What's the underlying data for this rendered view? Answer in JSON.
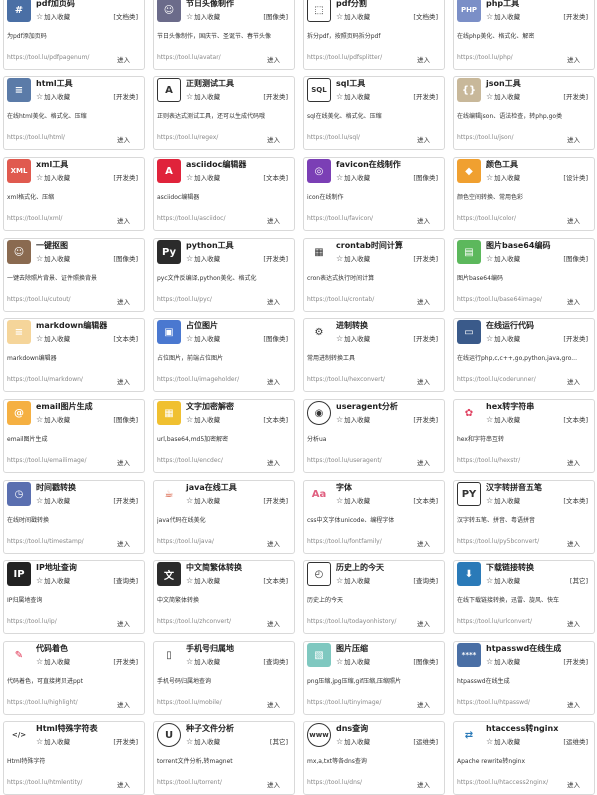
{
  "fav_label": "加入收藏",
  "enter_label": "进入",
  "tools": [
    {
      "title": "pdf加页码",
      "tag": "[文档类]",
      "desc": "为pdf添加页码",
      "link": "https://tool.lu/pdfpagenum/",
      "icon": "pdf-page-icon",
      "icon_text": "#",
      "color": "#4a6fa5"
    },
    {
      "title": "节日头像制作",
      "tag": "[图像类]",
      "desc": "节日头像制作，国庆节、圣诞节、春节头像",
      "link": "https://tool.lu/avatar/",
      "icon": "avatar-icon",
      "icon_text": "☺",
      "color": "#6b6b8a"
    },
    {
      "title": "pdf分割",
      "tag": "[文档类]",
      "desc": "拆分pdf，按照页码拆分pdf",
      "link": "https://tool.lu/pdfsplitter/",
      "icon": "pdf-split-icon",
      "icon_text": "⬚",
      "color": "#ffffff"
    },
    {
      "title": "php工具",
      "tag": "[开发类]",
      "desc": "在线php美化、格式化、解密",
      "link": "https://tool.lu/php/",
      "icon": "php-icon",
      "icon_text": "PHP",
      "color": "#7b8fc7"
    },
    {
      "title": "html工具",
      "tag": "[开发类]",
      "desc": "在线html美化、格式化、压缩",
      "link": "https://tool.lu/html/",
      "icon": "html-icon",
      "icon_text": "≡",
      "color": "#5b7ba8"
    },
    {
      "title": "正则测试工具",
      "tag": "[开发类]",
      "desc": "正则表达式测试工具，还可以生成代码哦",
      "link": "https://tool.lu/regex/",
      "icon": "regex-icon",
      "icon_text": "A",
      "color": "#ffffff"
    },
    {
      "title": "sql工具",
      "tag": "[开发类]",
      "desc": "sql在线美化、格式化、压缩",
      "link": "https://tool.lu/sql/",
      "icon": "sql-icon",
      "icon_text": "SQL",
      "color": "#ffffff"
    },
    {
      "title": "json工具",
      "tag": "[开发类]",
      "desc": "在线编辑json、语法检查，转php,go类",
      "link": "https://tool.lu/json/",
      "icon": "json-icon",
      "icon_text": "{}",
      "color": "#c8b89a"
    },
    {
      "title": "xml工具",
      "tag": "[开发类]",
      "desc": "xml格式化、压缩",
      "link": "https://tool.lu/xml/",
      "icon": "xml-icon",
      "icon_text": "XML",
      "color": "#e05a4f"
    },
    {
      "title": "asciidoc编辑器",
      "tag": "[文本类]",
      "desc": "asciidoc编辑器",
      "link": "https://tool.lu/asciidoc/",
      "icon": "asciidoc-icon",
      "icon_text": "A",
      "color": "#e0233b"
    },
    {
      "title": "favicon在线制作",
      "tag": "[图像类]",
      "desc": "icon在线制作",
      "link": "https://tool.lu/favicon/",
      "icon": "favicon-icon",
      "icon_text": "◎",
      "color": "#7b3fb5"
    },
    {
      "title": "颜色工具",
      "tag": "[设计类]",
      "desc": "颜色空间转换、常用色彩",
      "link": "https://tool.lu/color/",
      "icon": "color-palette-icon",
      "icon_text": "◆",
      "color": "#f0a030"
    },
    {
      "title": "一键抠图",
      "tag": "[图像类]",
      "desc": "一键去除照片背景、证件照换背景",
      "link": "https://tool.lu/cutout/",
      "icon": "cutout-icon",
      "icon_text": "☺",
      "color": "#8a6a50"
    },
    {
      "title": "python工具",
      "tag": "[开发类]",
      "desc": "pyc文件反编译,python美化、格式化",
      "link": "https://tool.lu/pyc/",
      "icon": "python-icon",
      "icon_text": "Py",
      "color": "#2b2b2b"
    },
    {
      "title": "crontab时间计算",
      "tag": "[开发类]",
      "desc": "cron表达式执行时间计算",
      "link": "https://tool.lu/crontab/",
      "icon": "crontab-icon",
      "icon_text": "▦",
      "color": "#ffffff"
    },
    {
      "title": "图片base64编码",
      "tag": "[图像类]",
      "desc": "图片base64编码",
      "link": "https://tool.lu/base64image/",
      "icon": "base64-image-icon",
      "icon_text": "▤",
      "color": "#5cb85c"
    },
    {
      "title": "markdown编辑器",
      "tag": "[文本类]",
      "desc": "markdown编辑器",
      "link": "https://tool.lu/markdown/",
      "icon": "markdown-icon",
      "icon_text": "≡",
      "color": "#f5d59a"
    },
    {
      "title": "占位图片",
      "tag": "[图像类]",
      "desc": "占位图片，前端占位图片",
      "link": "https://tool.lu/imageholder/",
      "icon": "placeholder-image-icon",
      "icon_text": "▣",
      "color": "#4a78d0"
    },
    {
      "title": "进制转换",
      "tag": "[开发类]",
      "desc": "常用进制转换工具",
      "link": "https://tool.lu/hexconvert/",
      "icon": "hex-convert-icon",
      "icon_text": "⚙",
      "color": "#ffffff"
    },
    {
      "title": "在线运行代码",
      "tag": "[开发类]",
      "desc": "在线运行php,c,c++,go,python,java,gro...",
      "link": "https://tool.lu/coderunner/",
      "icon": "code-runner-icon",
      "icon_text": "▭",
      "color": "#3a5a8a"
    },
    {
      "title": "email图片生成",
      "tag": "[图像类]",
      "desc": "email图片生成",
      "link": "https://tool.lu/emailimage/",
      "icon": "email-icon",
      "icon_text": "@",
      "color": "#f5b042"
    },
    {
      "title": "文字加密解密",
      "tag": "[文本类]",
      "desc": "url,base64,md5加密解密",
      "link": "https://tool.lu/encdec/",
      "icon": "encrypt-icon",
      "icon_text": "▦",
      "color": "#f0c030"
    },
    {
      "title": "useragent分析",
      "tag": "[开发类]",
      "desc": "分析ua",
      "link": "https://tool.lu/useragent/",
      "icon": "useragent-icon",
      "icon_text": "◉",
      "color": "#ffffff"
    },
    {
      "title": "hex转字符串",
      "tag": "[文本类]",
      "desc": "hex和字符串互转",
      "link": "https://tool.lu/hexstr/",
      "icon": "hex-string-icon",
      "icon_text": "✿",
      "color": "#ffffff"
    },
    {
      "title": "时间戳转换",
      "tag": "[开发类]",
      "desc": "在线时间戳转换",
      "link": "https://tool.lu/timestamp/",
      "icon": "timestamp-icon",
      "icon_text": "◷",
      "color": "#5a6fb0"
    },
    {
      "title": "java在线工具",
      "tag": "[开发类]",
      "desc": "java代码在线美化",
      "link": "https://tool.lu/java/",
      "icon": "java-icon",
      "icon_text": "☕",
      "color": "#ffffff"
    },
    {
      "title": "字体",
      "tag": "[文本类]",
      "desc": "css中文字体unicode、编程字体",
      "link": "https://tool.lu/fontfamily/",
      "icon": "font-icon",
      "icon_text": "Aa",
      "color": "#ffffff"
    },
    {
      "title": "汉字转拼音五笔",
      "tag": "[文本类]",
      "desc": "汉字转五笔、拼音、粤语拼音",
      "link": "https://tool.lu/py5bconvert/",
      "icon": "pinyin-icon",
      "icon_text": "PY",
      "color": "#ffffff"
    },
    {
      "title": "IP地址查询",
      "tag": "[查询类]",
      "desc": "IP归属地查询",
      "link": "https://tool.lu/ip/",
      "icon": "ip-location-icon",
      "icon_text": "IP",
      "color": "#222222"
    },
    {
      "title": "中文简繁体转换",
      "tag": "[文本类]",
      "desc": "中文简繁体转换",
      "link": "https://tool.lu/zhconvert/",
      "icon": "translate-icon",
      "icon_text": "文",
      "color": "#2b2b2b"
    },
    {
      "title": "历史上的今天",
      "tag": "[查询类]",
      "desc": "历史上的今天",
      "link": "https://tool.lu/todayonhistory/",
      "icon": "history-icon",
      "icon_text": "◴",
      "color": "#ffffff"
    },
    {
      "title": "下载链接转换",
      "tag": "[其它]",
      "desc": "在线下载链接转换，迅雷、旋风、快车",
      "link": "https://tool.lu/urlconvert/",
      "icon": "download-icon",
      "icon_text": "⬇",
      "color": "#2a7ab8"
    },
    {
      "title": "代码着色",
      "tag": "[开发类]",
      "desc": "代码着色，可直接拷贝进ppt",
      "link": "https://tool.lu/highlight/",
      "icon": "highlight-icon",
      "icon_text": "✎",
      "color": "#ffffff"
    },
    {
      "title": "手机号归属地",
      "tag": "[查询类]",
      "desc": "手机号码归属地查询",
      "link": "https://tool.lu/mobile/",
      "icon": "mobile-icon",
      "icon_text": "▯",
      "color": "#ffffff"
    },
    {
      "title": "图片压缩",
      "tag": "[图像类]",
      "desc": "png压缩,jpg压缩,gif压缩,压缩照片",
      "link": "https://tool.lu/tinyimage/",
      "icon": "image-compress-icon",
      "icon_text": "▧",
      "color": "#7fc8c0"
    },
    {
      "title": "htpasswd在线生成",
      "tag": "[开发类]",
      "desc": "htpasswd在线生成",
      "link": "https://tool.lu/htpasswd/",
      "icon": "password-icon",
      "icon_text": "****",
      "color": "#4a6fa5"
    },
    {
      "title": "Html特殊字符表",
      "tag": "[开发类]",
      "desc": "Html特殊字符",
      "link": "https://tool.lu/htmlentity/",
      "icon": "html-entity-icon",
      "icon_text": "</>",
      "color": "#ffffff"
    },
    {
      "title": "种子文件分析",
      "tag": "[其它]",
      "desc": "torrent文件分析,转magnet",
      "link": "https://tool.lu/torrent/",
      "icon": "torrent-icon",
      "icon_text": "U",
      "color": "#ffffff"
    },
    {
      "title": "dns查询",
      "tag": "[运维类]",
      "desc": "mx,a,txt等各dns查询",
      "link": "https://tool.lu/dns/",
      "icon": "dns-icon",
      "icon_text": "www",
      "color": "#ffffff"
    },
    {
      "title": "htaccess转nginx",
      "tag": "[运维类]",
      "desc": "Apache rewrite转nginx",
      "link": "https://tool.lu/htaccess2nginx/",
      "icon": "htaccess-icon",
      "icon_text": "⇄",
      "color": "#ffffff"
    }
  ]
}
